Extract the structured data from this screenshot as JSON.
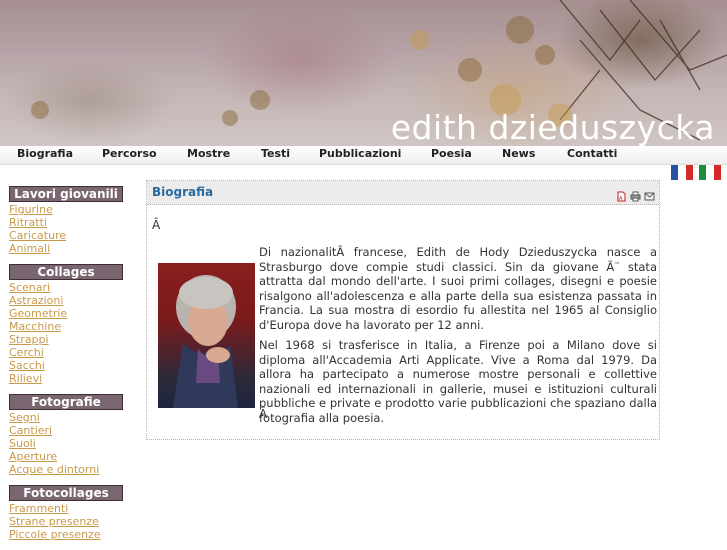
{
  "site": {
    "title": "edith dzieduszycka"
  },
  "nav": {
    "items": [
      "Biografia",
      "Percorso",
      "Mostre",
      "Testi",
      "Pubblicazioni",
      "Poesia",
      "News",
      "Contatti"
    ]
  },
  "flags": [
    {
      "name": "french-flag",
      "colors": [
        "#2851a6",
        "#ffffff",
        "#d42a2a"
      ]
    },
    {
      "name": "italian-flag",
      "colors": [
        "#1e8c3c",
        "#ffffff",
        "#d42a2a"
      ]
    }
  ],
  "sidebar": {
    "sections": [
      {
        "title": "Lavori giovanili",
        "items": [
          "Figurine",
          "Ritratti",
          "Caricature",
          "Animali"
        ]
      },
      {
        "title": "Collages",
        "items": [
          "Scenari",
          "Astrazioni",
          "Geometrie",
          "Macchine",
          "Strappi",
          "Cerchi",
          "Sacchi",
          "Rilievi"
        ]
      },
      {
        "title": "Fotografie",
        "items": [
          "Segni",
          "Cantieri",
          "Suoli",
          "Aperture",
          "Acque e dintorni"
        ]
      },
      {
        "title": "Fotocollages",
        "items": [
          "Frammenti",
          "Strane presenze",
          "Piccole presenze"
        ]
      }
    ]
  },
  "content": {
    "title": "Biografia",
    "icons": [
      "pdf-icon",
      "print-icon",
      "email-icon"
    ],
    "stray_top": "Â",
    "stray_bottom": "Â",
    "paragraphs": [
      "Di nazionalitÃ  francese, Edith de Hody Dzieduszycka nasce a Strasburgo dove compie studi classici. Sin da giovane Ã¨ stata attratta dal mondo dell'arte. I suoi primi collages, disegni e poesie risalgono all'adolescenza e alla parte della sua esistenza passata in Francia. La sua mostra di esordio fu allestita nel 1965 al Consiglio d'Europa dove ha lavorato per 12 anni.",
      "Nel 1968 si trasferisce in Italia, a Firenze poi a Milano dove si diploma all'Accademia Arti Applicate. Vive a Roma dal 1979. Da allora ha partecipato a numerose mostre personali e collettive nazionali ed internazionali in gallerie, musei e istituzioni culturali pubbliche e private e prodotto varie pubblicazioni che spaziano dalla fotografia alla poesia."
    ]
  }
}
